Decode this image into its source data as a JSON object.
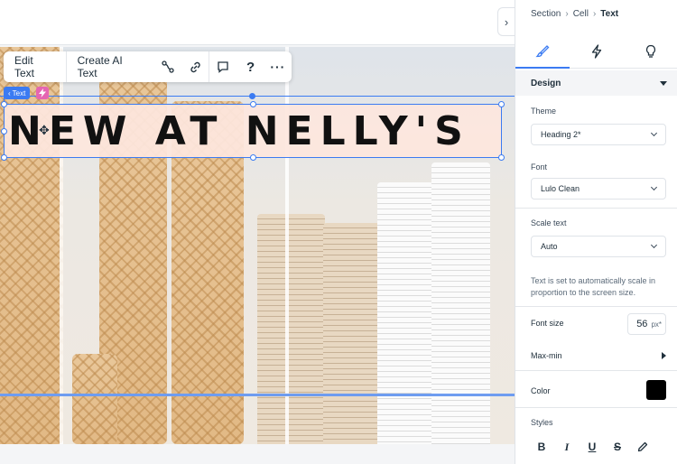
{
  "canvas": {
    "heading_text": "NEW AT NELLY'S",
    "tags": {
      "element_label": "Text"
    }
  },
  "toolbar": {
    "edit_text_label": "Edit Text",
    "create_ai_text_label": "Create AI Text"
  },
  "panel": {
    "breadcrumb": [
      "Section",
      "Cell",
      "Text"
    ],
    "tabs": [
      "design-brush-icon",
      "interactions-bolt-icon",
      "help-bulb-icon"
    ],
    "section_title": "Design",
    "theme": {
      "label": "Theme",
      "value": "Heading 2*"
    },
    "font": {
      "label": "Font",
      "value": "Lulo Clean"
    },
    "scale_text": {
      "label": "Scale text",
      "value": "Auto"
    },
    "scale_note": "Text is set to automatically scale in proportion to the screen size.",
    "font_size": {
      "label": "Font size",
      "value": "56",
      "unit": "px*"
    },
    "max_min_label": "Max-min",
    "color": {
      "label": "Color",
      "value": "#000000"
    },
    "styles_label": "Styles"
  },
  "colors": {
    "selection_blue": "#3b7bf2",
    "accent_pink": "#e565b2",
    "text_box_bg": "#fde6de"
  }
}
